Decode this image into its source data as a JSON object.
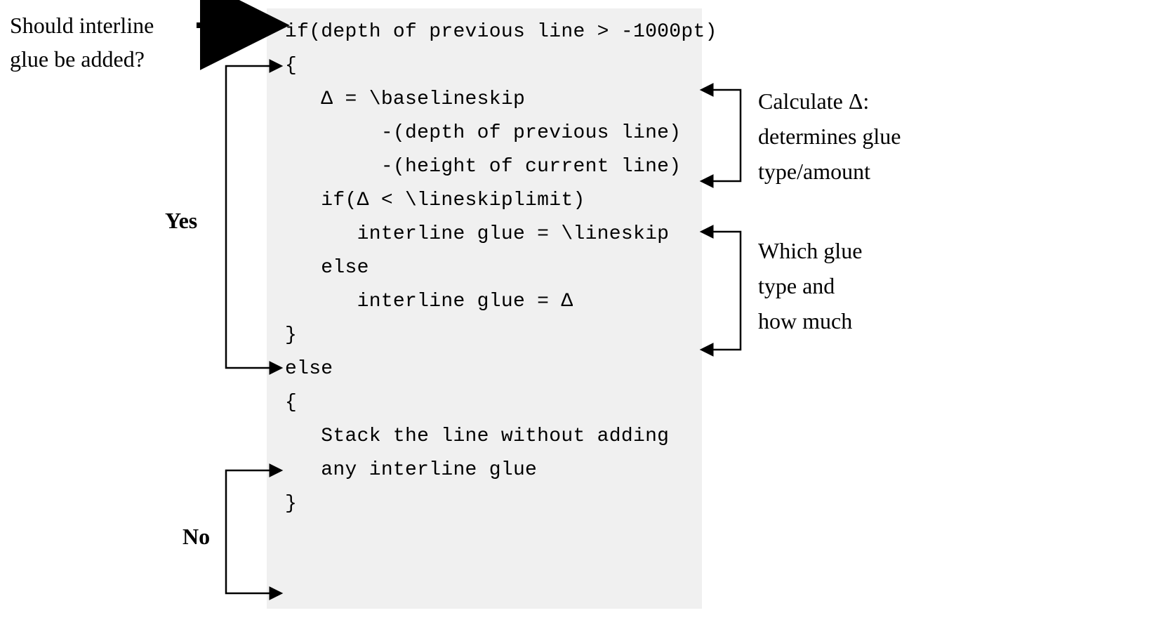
{
  "labels": {
    "question_l1": "Should interline",
    "question_l2": "glue be added?",
    "yes": "Yes",
    "no": "No",
    "calc_l1": "Calculate Δ:",
    "calc_l2": "determines glue",
    "calc_l3": "type/amount",
    "which_l1": "Which glue",
    "which_l2": "type and",
    "which_l3": "how much"
  },
  "code": {
    "l01": "if(depth of previous line > -1000pt)",
    "l02": "{",
    "l03": "   Δ = \\baselineskip",
    "l04": "        -(depth of previous line)",
    "l05": "        -(height of current line)",
    "l06": "",
    "l07": "   if(Δ < \\lineskiplimit)",
    "l08": "      interline glue = \\lineskip",
    "l09": "   else",
    "l10": "      interline glue = Δ",
    "l11": "}",
    "l12": "",
    "l13": "else",
    "l14": "{",
    "l15": "   Stack the line without adding",
    "l16": "   any interline glue",
    "l17": "}"
  }
}
